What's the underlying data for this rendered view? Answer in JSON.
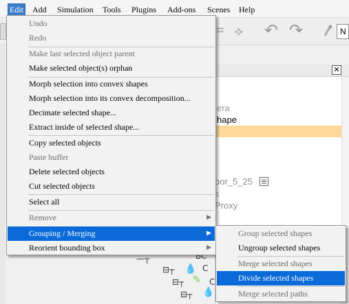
{
  "menubar": {
    "items": [
      "Edit",
      "Add",
      "Simulation",
      "Tools",
      "Plugins",
      "Add-ons",
      "Scenes",
      "Help"
    ]
  },
  "toolbar": {
    "field_text": "N"
  },
  "scene": {
    "close_symbol": "✕",
    "rows": [
      "era",
      "hape",
      "oor_5_25",
      "s",
      "Proxy"
    ],
    "tree_labels": [
      "BC",
      "C",
      "C"
    ]
  },
  "edit_menu": {
    "items": [
      {
        "label": "Undo",
        "enabled": false
      },
      {
        "label": "Redo",
        "enabled": false
      },
      {
        "label": "Make last selected object parent",
        "enabled": false
      },
      {
        "label": "Make selected object(s) orphan",
        "enabled": true
      },
      {
        "label": "Morph selection into convex shapes",
        "enabled": true
      },
      {
        "label": "Morph selection into its convex decomposition...",
        "enabled": true
      },
      {
        "label": "Decimate selected shape...",
        "enabled": true
      },
      {
        "label": "Extract inside of selected shape...",
        "enabled": true
      },
      {
        "label": "Copy selected objects",
        "enabled": true
      },
      {
        "label": "Paste buffer",
        "enabled": false
      },
      {
        "label": "Delete selected objects",
        "enabled": true
      },
      {
        "label": "Cut selected objects",
        "enabled": true
      },
      {
        "label": "Select all",
        "enabled": true
      },
      {
        "label": "Remove",
        "enabled": false
      },
      {
        "label": "Grouping / Merging",
        "enabled": true,
        "selected": true
      },
      {
        "label": "Reorient bounding box",
        "enabled": true
      }
    ]
  },
  "submenu": {
    "items": [
      {
        "label": "Group selected shapes",
        "enabled": false
      },
      {
        "label": "Ungroup selected shapes",
        "enabled": true
      },
      {
        "label": "Merge selected shapes",
        "enabled": false
      },
      {
        "label": "Divide selected shapes",
        "enabled": true,
        "selected": true
      },
      {
        "label": "Merge selected paths",
        "enabled": false
      }
    ]
  },
  "icons": {
    "submenu_arrow": "▶",
    "undo": "↶",
    "redo": "↷"
  },
  "colors": {
    "selection": "#0a6ad8",
    "menubar_active": "#3b7cc9",
    "scene_highlight": "#fdd89a"
  }
}
